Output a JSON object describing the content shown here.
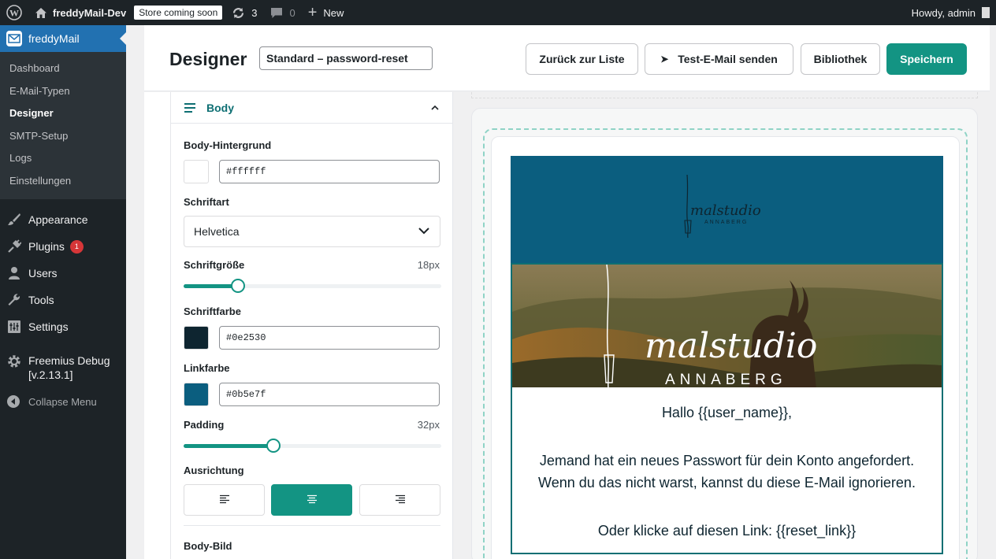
{
  "admin_bar": {
    "site_name": "freddyMail-Dev",
    "store_badge": "Store coming soon",
    "updates_count": "3",
    "comments_count": "0",
    "new_label": "New",
    "howdy": "Howdy, admin"
  },
  "sidebar": {
    "plugin_name": "freddyMail",
    "submenu": [
      "Dashboard",
      "E-Mail-Typen",
      "Designer",
      "SMTP-Setup",
      "Logs",
      "Einstellungen"
    ],
    "active_submenu": "Designer",
    "items": [
      {
        "label": "Appearance",
        "icon": "paintbrush-icon"
      },
      {
        "label": "Plugins",
        "icon": "plug-icon",
        "badge": "1"
      },
      {
        "label": "Users",
        "icon": "user-icon"
      },
      {
        "label": "Tools",
        "icon": "wrench-icon"
      },
      {
        "label": "Settings",
        "icon": "settings-icon"
      }
    ],
    "freemius_line1": "Freemius Debug",
    "freemius_line2": "[v.2.13.1]",
    "collapse": "Collapse Menu"
  },
  "header": {
    "title": "Designer",
    "template_name": "Standard – password-reset",
    "btn_back": "Zurück zur Liste",
    "btn_test": "Test-E-Mail senden",
    "btn_library": "Bibliothek",
    "btn_save": "Speichern"
  },
  "panel": {
    "section_title": "Body",
    "body_bg_label": "Body-Hintergrund",
    "body_bg_value": "#ffffff",
    "font_label": "Schriftart",
    "font_value": "Helvetica",
    "font_size_label": "Schriftgröße",
    "font_size_value": "18px",
    "font_size_fraction": 0.21,
    "font_color_label": "Schriftfarbe",
    "font_color_value": "#0e2530",
    "link_color_label": "Linkfarbe",
    "link_color_value": "#0b5e7f",
    "padding_label": "Padding",
    "padding_value": "32px",
    "padding_fraction": 0.35,
    "align_label": "Ausrichtung",
    "align_selected": "center",
    "body_image_label": "Body-Bild"
  },
  "email": {
    "logo_main": "malstudio",
    "logo_sub": "ANNABERG",
    "hero_main": "malstudio",
    "hero_sub": "ANNABERG",
    "greeting": "Hallo {{user_name}},",
    "line1": "Jemand hat ein neues Passwort für dein Konto angefordert.",
    "line2": "Wenn du das nicht warst, kannst du diese E-Mail ignorieren.",
    "line3": "Oder klicke auf diesen Link: {{reset_link}}"
  },
  "colors": {
    "accent": "#139483",
    "header_bg": "#0b5e7f",
    "wp_blue": "#2271b1",
    "admin_dark": "#1d2327"
  }
}
